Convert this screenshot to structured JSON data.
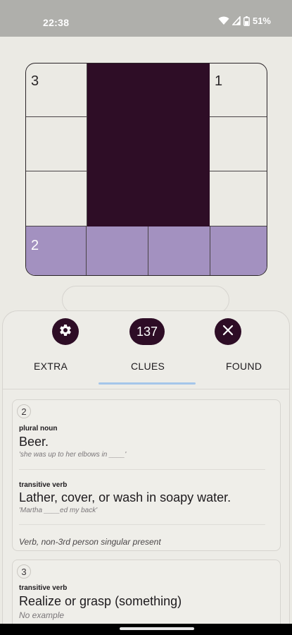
{
  "status": {
    "time": "22:38",
    "battery": "51%"
  },
  "grid": {
    "numbers": {
      "three": "3",
      "one": "1",
      "two": "2"
    }
  },
  "panel": {
    "counter": "137",
    "tabs": [
      "EXTRA",
      "CLUES",
      "FOUND"
    ]
  },
  "clues": [
    {
      "number": "2",
      "senses": [
        {
          "pos": "plural noun",
          "definition": "Beer.",
          "example": "'she was up to her elbows in ____'"
        },
        {
          "pos": "transitive verb",
          "definition": "Lather, cover, or wash in soapy water.",
          "example": "'Martha ____ed my back'"
        }
      ],
      "note": "Verb, non-3rd person singular present"
    },
    {
      "number": "3",
      "senses": [
        {
          "pos": "transitive verb",
          "definition": "Realize or grasp (something)",
          "example": "No example"
        }
      ]
    }
  ],
  "colors": {
    "dark": "#2e0d26",
    "highlight": "#a391c0",
    "tab_indicator": "#a5c6ea"
  },
  "icons": [
    "wifi-icon",
    "signal-icon",
    "battery-icon",
    "gear-icon",
    "close-icon"
  ]
}
